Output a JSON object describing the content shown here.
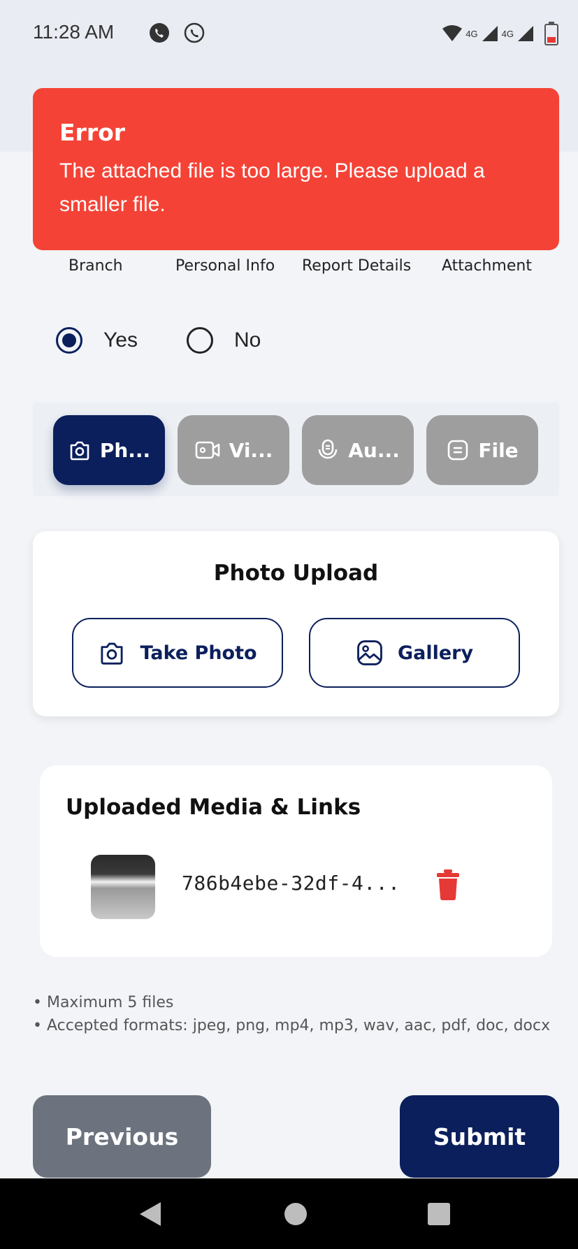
{
  "status_bar": {
    "time": "11:28 AM",
    "left_icons": [
      "whatsapp-icon",
      "phone-call-icon"
    ],
    "network_1": "4G",
    "network_2": "4G",
    "battery_color": "#e53935"
  },
  "error": {
    "title": "Error",
    "message": "The attached file is too large. Please upload a smaller file.",
    "color": "#f44336"
  },
  "steps": [
    "Branch",
    "Personal Info",
    "Report Details",
    "Attachment"
  ],
  "radio": {
    "options": [
      {
        "label": "Yes",
        "selected": true
      },
      {
        "label": "No",
        "selected": false
      }
    ]
  },
  "media_tabs": [
    {
      "label": "Ph...",
      "icon": "camera-icon",
      "active": true
    },
    {
      "label": "Vi...",
      "icon": "video-icon",
      "active": false
    },
    {
      "label": "Au...",
      "icon": "microphone-icon",
      "active": false
    },
    {
      "label": "File",
      "icon": "file-icon",
      "active": false
    }
  ],
  "photo_upload": {
    "title": "Photo Upload",
    "take_photo_label": "Take Photo",
    "gallery_label": "Gallery"
  },
  "uploaded": {
    "title": "Uploaded Media & Links",
    "items": [
      {
        "filename": "786b4ebe-32df-4...",
        "thumbnail": "image-thumbnail"
      }
    ]
  },
  "notes": {
    "line1": "• Maximum 5 files",
    "line2": "• Accepted formats: jpeg, png, mp4, mp3, wav, aac, pdf, doc, docx"
  },
  "footer": {
    "previous_label": "Previous",
    "submit_label": "Submit"
  },
  "colors": {
    "primary": "#0b1f5c",
    "inactive_tab": "#9e9e9e",
    "previous_button": "#6c737e",
    "delete": "#e53935"
  }
}
